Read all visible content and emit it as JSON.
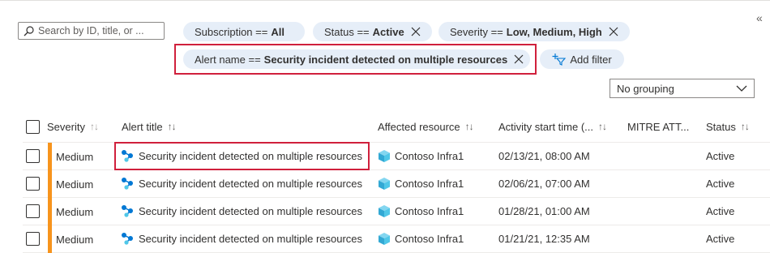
{
  "search": {
    "placeholder": "Search by ID, title, or ..."
  },
  "filters": [
    {
      "label": "Subscription ==",
      "value": "All",
      "removable": false
    },
    {
      "label": "Status ==",
      "value": "Active",
      "removable": true
    },
    {
      "label": "Severity ==",
      "value": "Low, Medium, High",
      "removable": true
    },
    {
      "label": "Alert name ==",
      "value": "Security incident detected on multiple resources",
      "removable": true,
      "highlighted": true
    }
  ],
  "add_filter_label": "Add filter",
  "grouping": {
    "selected": "No grouping"
  },
  "columns": {
    "severity": "Severity",
    "alert_title": "Alert title",
    "affected_resource": "Affected resource",
    "activity_start_time": "Activity start time (...",
    "mitre": "MITRE ATT...",
    "status": "Status"
  },
  "rows": [
    {
      "severity": "Medium",
      "title": "Security incident detected on multiple resources",
      "resource": "Contoso Infra1",
      "start_time": "02/13/21, 08:00 AM",
      "status": "Active",
      "highlighted": true
    },
    {
      "severity": "Medium",
      "title": "Security incident detected on multiple resources",
      "resource": "Contoso Infra1",
      "start_time": "02/06/21, 07:00 AM",
      "status": "Active"
    },
    {
      "severity": "Medium",
      "title": "Security incident detected on multiple resources",
      "resource": "Contoso Infra1",
      "start_time": "01/28/21, 01:00 AM",
      "status": "Active"
    },
    {
      "severity": "Medium",
      "title": "Security incident detected on multiple resources",
      "resource": "Contoso Infra1",
      "start_time": "01/21/21, 12:35 AM",
      "status": "Active"
    }
  ],
  "icons": {
    "search": "search-icon",
    "remove": "close-icon",
    "add_filter": "add-filter-icon",
    "dropdown": "chevron-down-icon",
    "alert": "incident-icon",
    "resource": "cube-icon",
    "collapse": "double-chevron-left-icon"
  },
  "colors": {
    "pill_bg": "#e6eef8",
    "highlight": "#d0203c",
    "severity_medium": "#f7941d",
    "incident_icon": "#0078d4",
    "resource_icon": "#50c7e8"
  }
}
